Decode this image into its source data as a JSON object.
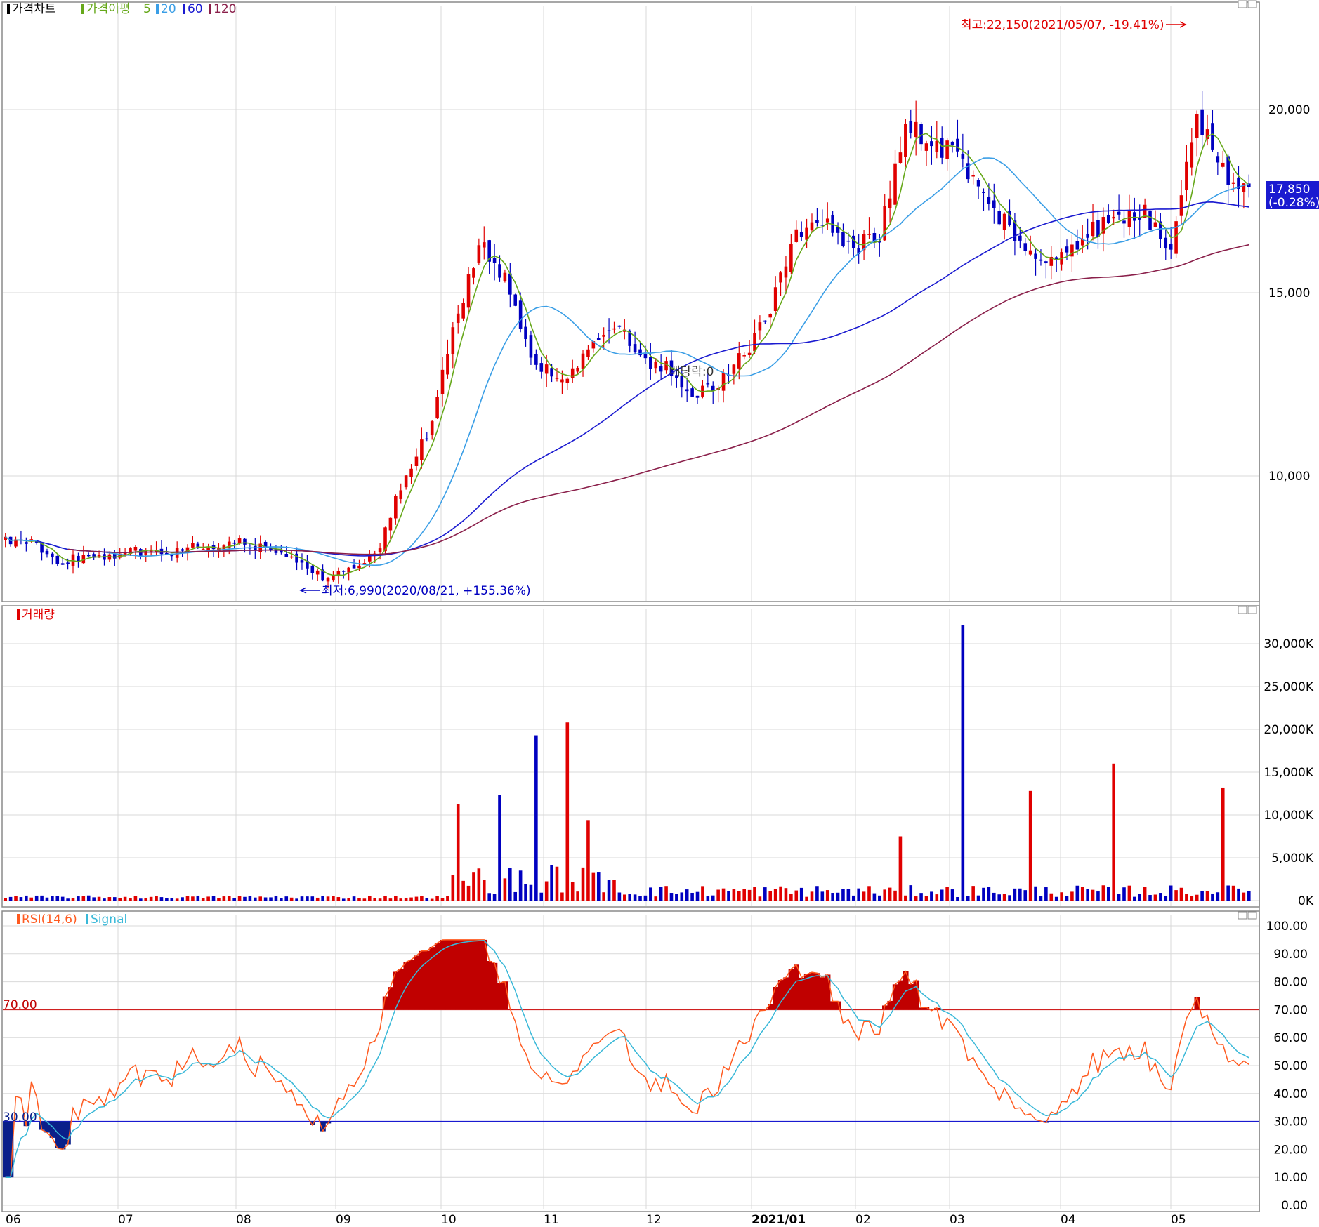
{
  "panels": {
    "price": {
      "legend": {
        "title": "가격차트",
        "ma_label": "가격이평",
        "ma_periods": [
          "5",
          "20",
          "60",
          "120"
        ]
      },
      "high_annotation": "최고:22,150(2021/05/07, -19.41%)",
      "low_annotation": "최저:6,990(2020/08/21, +155.36%)",
      "dividend_annotation": "배당락:0",
      "current_price": "17,850",
      "current_change": "(-0.28%)"
    },
    "volume": {
      "legend": {
        "title": "거래량"
      }
    },
    "rsi": {
      "legend": {
        "title": "RSI(14,6)",
        "signal": "Signal"
      },
      "level_high_label": "70.00",
      "level_low_label": "30.00"
    }
  },
  "colors": {
    "up": "#e00000",
    "down": "#0000c0",
    "ma5": "#66a81a",
    "ma20": "#3a9ee6",
    "ma60": "#1a1ad0",
    "ma120": "#8a1f4a",
    "rsi": "#ff5a1f",
    "signal": "#38b8d8",
    "rsi_hi_fill": "#c00000",
    "rsi_lo_fill": "#0a1f8a",
    "grid": "#d9d9d9"
  },
  "chart_data": [
    {
      "type": "candlestick",
      "name": "가격차트",
      "x_ticks": [
        "06",
        "07",
        "08",
        "09",
        "10",
        "11",
        "12",
        "2021/01",
        "02",
        "03",
        "04",
        "05"
      ],
      "y_ticks": [
        "10,000",
        "15,000",
        "20,000"
      ],
      "approx_close_by_week": [
        8300,
        8200,
        7700,
        7750,
        7800,
        7950,
        7850,
        8100,
        8150,
        8200,
        7950,
        7700,
        7200,
        7500,
        7850,
        9800,
        11200,
        14300,
        16400,
        15200,
        13100,
        12600,
        13400,
        14200,
        13200,
        13000,
        12200,
        12500,
        13400,
        14800,
        16700,
        16900,
        16200,
        16500,
        19600,
        19100,
        18800,
        17500,
        16800,
        15700,
        16200,
        16700,
        17000,
        17200,
        16200,
        20000,
        18300,
        17850
      ],
      "ylim": [
        6500,
        23000
      ]
    },
    {
      "type": "bar",
      "name": "거래량",
      "x_ticks": [
        "06",
        "07",
        "08",
        "09",
        "10",
        "11",
        "12",
        "2021/01",
        "02",
        "03",
        "04",
        "05"
      ],
      "y_ticks": [
        "0K",
        "5,000K",
        "10,000K",
        "15,000K",
        "20,000K",
        "25,000K",
        "30,000K"
      ],
      "approx_peaks_k": [
        11300,
        12300,
        19300,
        20800,
        9400,
        7500,
        32200,
        12800,
        16000,
        13200
      ],
      "ylim": [
        0,
        33000
      ]
    },
    {
      "type": "line",
      "series": [
        {
          "name": "RSI(14,6)"
        },
        {
          "name": "Signal"
        }
      ],
      "y_ticks": [
        "0.00",
        "10.00",
        "20.00",
        "30.00",
        "40.00",
        "50.00",
        "60.00",
        "70.00",
        "80.00",
        "90.00",
        "100.00"
      ],
      "ylim": [
        0,
        100
      ],
      "levels": [
        70,
        30
      ],
      "approx_rsi_extremes": [
        89,
        17,
        79,
        18,
        71
      ]
    }
  ]
}
